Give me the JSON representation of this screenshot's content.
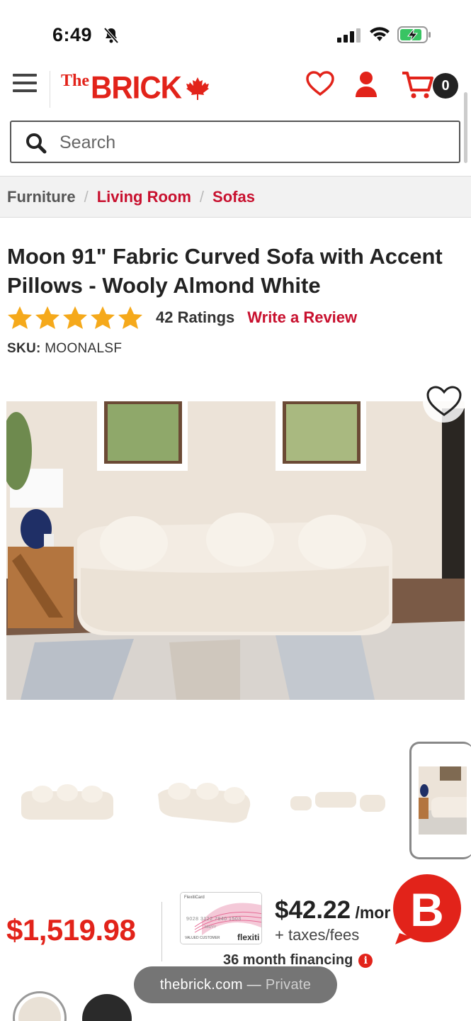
{
  "status_bar": {
    "time": "6:49",
    "icons": [
      "bell-slash-icon",
      "cellular-signal-icon",
      "wifi-icon",
      "battery-charging-icon"
    ]
  },
  "header": {
    "logo_prefix": "The",
    "logo_main": "BRICK",
    "cart_count": "0",
    "brand_color": "#e2231a"
  },
  "search": {
    "placeholder": "Search"
  },
  "breadcrumb": {
    "items": [
      "Furniture",
      "Living Room",
      "Sofas"
    ],
    "separator": "/"
  },
  "product": {
    "title": "Moon 91\" Fabric Curved Sofa with Accent Pillows - Wooly Almond White",
    "stars": 5,
    "ratings_text": "42 Ratings",
    "write_review": "Write a Review",
    "sku_label": "SKU:",
    "sku_value": "MOONALSF"
  },
  "gallery": {
    "thumbnails": [
      "sofa-front-view",
      "sofa-angled-view",
      "sofa-set-view",
      "sofa-room-view"
    ],
    "selected_index": 3
  },
  "pricing": {
    "price": "$1,519.98",
    "card_brand": "flexiti",
    "card_label": "FlexitiCard",
    "card_number": "9028 3122 7840 1503",
    "card_holder": "VALUED CUSTOMER",
    "card_exp": "MM/YY",
    "monthly_amount": "$42.22",
    "monthly_suffix": " /mor",
    "taxes_note": "+ taxes/fees",
    "financing_text": "36 month financing"
  },
  "swatches": [
    {
      "name": "Wooly Almond White",
      "color": "#e9e1d6"
    },
    {
      "name": "Dark",
      "color": "#2a2a2a"
    }
  ],
  "browser_pill": {
    "domain": "thebrick.com",
    "separator": " — ",
    "mode": "Private"
  }
}
